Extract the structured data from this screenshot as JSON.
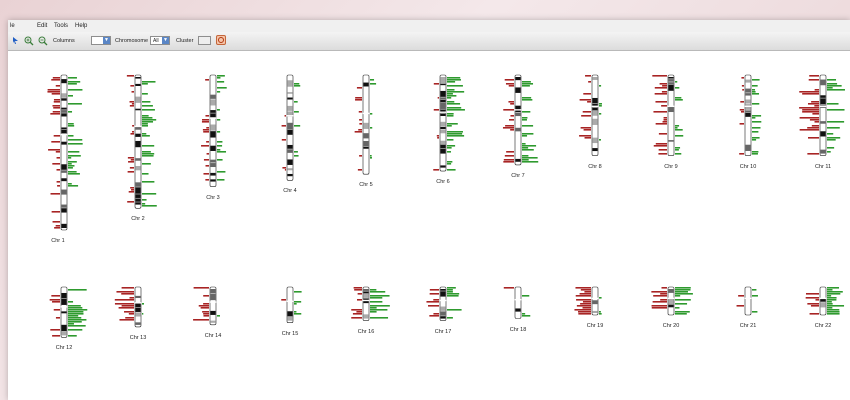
{
  "menu": [
    "le",
    "Edit",
    "Tools",
    "Help"
  ],
  "toolbar": {
    "columns_label": "Columns",
    "columns_value": "",
    "chromosome_label": "Chromosome",
    "chromosome_value": "All",
    "cluster_label": "Cluster",
    "cluster_value": ""
  },
  "colors": {
    "gain": "#2e9a2e",
    "loss": "#a82424",
    "ideogram_outline": "#222222"
  },
  "chromosomes": [
    {
      "label": "Chr 1",
      "length": 1.0,
      "loss": 0.25,
      "gain": 0.3
    },
    {
      "label": "Chr 2",
      "length": 0.86,
      "loss": 0.1,
      "gain": 0.3
    },
    {
      "label": "Chr 3",
      "length": 0.72,
      "loss": 0.12,
      "gain": 0.18
    },
    {
      "label": "Chr 4",
      "length": 0.68,
      "loss": 0.02,
      "gain": 0.08
    },
    {
      "label": "Chr 5",
      "length": 0.64,
      "loss": 0.12,
      "gain": 0.08
    },
    {
      "label": "Chr 6",
      "length": 0.62,
      "loss": 0.05,
      "gain": 0.4
    },
    {
      "label": "Chr 7",
      "length": 0.58,
      "loss": 0.25,
      "gain": 0.35
    },
    {
      "label": "Chr 8",
      "length": 0.52,
      "loss": 0.22,
      "gain": 0.02
    },
    {
      "label": "Chr 9",
      "length": 0.52,
      "loss": 0.3,
      "gain": 0.2
    },
    {
      "label": "Chr 10",
      "length": 0.52,
      "loss": 0.05,
      "gain": 0.15
    },
    {
      "label": "Chr 11",
      "length": 0.52,
      "loss": 0.45,
      "gain": 0.4
    },
    {
      "label": "Chr 12",
      "length": 0.48,
      "loss": 0.25,
      "gain": 0.55
    },
    {
      "label": "Chr 13",
      "length": 0.38,
      "loss": 0.6,
      "gain": 0.02
    },
    {
      "label": "Chr 14",
      "length": 0.36,
      "loss": 0.35,
      "gain": 0.05
    },
    {
      "label": "Chr 15",
      "length": 0.34,
      "loss": 0.05,
      "gain": 0.2
    },
    {
      "label": "Chr 16",
      "length": 0.32,
      "loss": 0.25,
      "gain": 0.7
    },
    {
      "label": "Chr 17",
      "length": 0.32,
      "loss": 0.25,
      "gain": 0.4
    },
    {
      "label": "Chr 18",
      "length": 0.3,
      "loss": 0.25,
      "gain": 0.2
    },
    {
      "label": "Chr 19",
      "length": 0.26,
      "loss": 0.85,
      "gain": 0.05
    },
    {
      "label": "Chr 20",
      "length": 0.24,
      "loss": 0.5,
      "gain": 0.75
    },
    {
      "label": "Chr 21",
      "length": 0.18,
      "loss": 0.1,
      "gain": 0.35
    },
    {
      "label": "Chr 22",
      "length": 0.18,
      "loss": 0.3,
      "gain": 0.85
    }
  ]
}
